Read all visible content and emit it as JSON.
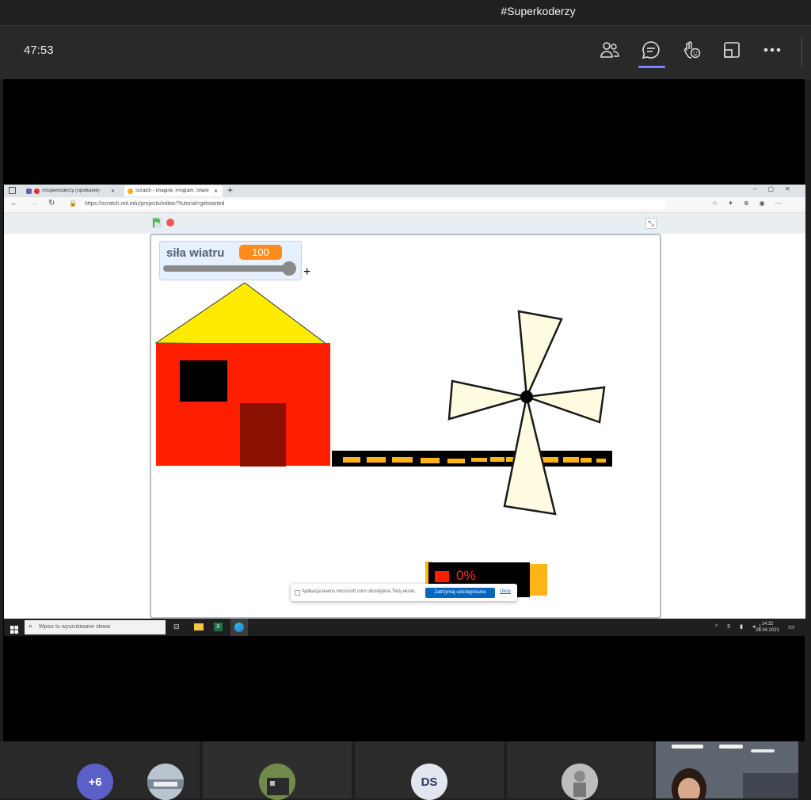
{
  "window": {
    "title": "#Superkoderzy"
  },
  "meeting": {
    "timer": "47:53",
    "toolbar_icons": [
      "people-icon",
      "chat-icon",
      "reactions-icon",
      "share-tray-icon",
      "more-options-icon"
    ],
    "accent_color": "#7f85f5"
  },
  "browser": {
    "tabs": [
      {
        "label": "#Superkoderzy (Spotkanie)"
      },
      {
        "label": "Scratch - Imagine, Program, Share"
      }
    ],
    "new_tab": "+",
    "url": "https://scratch.mit.edu/projects/editor/?tutorial=getstarted"
  },
  "scratch": {
    "variable_monitor": {
      "label": "siła wiatru",
      "value": "100",
      "slider_level": 1.0
    },
    "battery_text": "0%",
    "colors": {
      "roof": "#ffea00",
      "wall": "#ff1e00",
      "door": "#8b1200",
      "blade": "#fffbe0",
      "belt_dash": "#ffb515",
      "monitor_value": "#ff8c1a"
    }
  },
  "share_notification": {
    "text": "Aplikacja teams.microsoft.com udostępnia Twój ekran.",
    "stop_button": "Zatrzymaj udostępnianie",
    "hide_link": "Ukryj"
  },
  "os_taskbar": {
    "search_placeholder": "Wpisz tu wyszukiwane słowa",
    "time": "14:32",
    "date": "28.04.2021"
  },
  "participants": {
    "overflow": "+6",
    "initials": "DS"
  }
}
